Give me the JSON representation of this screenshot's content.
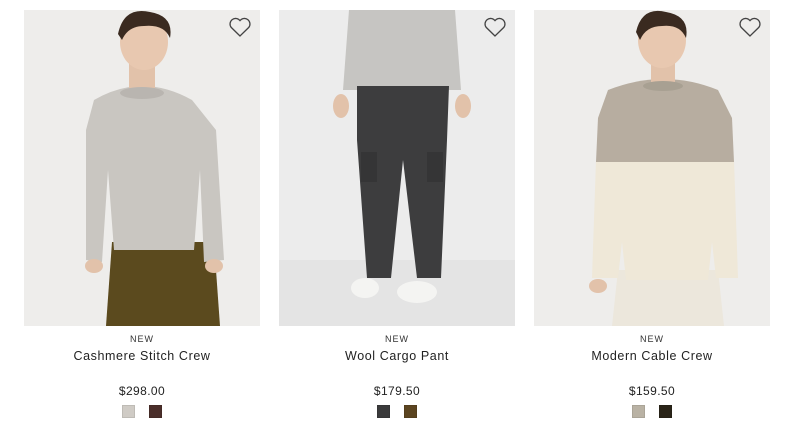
{
  "products": [
    {
      "badge": "NEW",
      "name": "Cashmere Stitch Crew",
      "price": "$298.00",
      "favorite_icon": "heart-outline-icon",
      "swatches": [
        {
          "color": "#cfcbc5"
        },
        {
          "color": "#4a2e2a"
        }
      ]
    },
    {
      "badge": "NEW",
      "name": "Wool Cargo Pant",
      "price": "$179.50",
      "favorite_icon": "heart-outline-icon",
      "swatches": [
        {
          "color": "#3a3a3b"
        },
        {
          "color": "#5b4420"
        }
      ]
    },
    {
      "badge": "NEW",
      "name": "Modern Cable Crew",
      "price": "$159.50",
      "favorite_icon": "heart-outline-icon",
      "swatches": [
        {
          "color": "#b9b2a4"
        },
        {
          "color": "#2a2418"
        }
      ]
    }
  ]
}
